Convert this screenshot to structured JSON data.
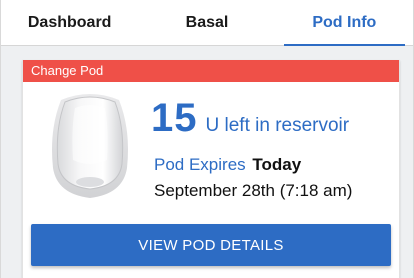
{
  "tabs": [
    {
      "label": "Dashboard",
      "active": false
    },
    {
      "label": "Basal",
      "active": false
    },
    {
      "label": "Pod Info",
      "active": true
    }
  ],
  "card": {
    "header": "Change Pod",
    "reservoir_units": "15",
    "reservoir_text": "U left in reservoir",
    "expires_label": "Pod Expires",
    "expires_value": "Today",
    "expires_date": "September 28th (7:18 am)",
    "button_label": "VIEW POD DETAILS"
  },
  "colors": {
    "accent": "#2d6cc4",
    "alert": "#ef5048",
    "panel": "#eef0f2"
  },
  "icons": {
    "pod": "pod-device-icon"
  }
}
